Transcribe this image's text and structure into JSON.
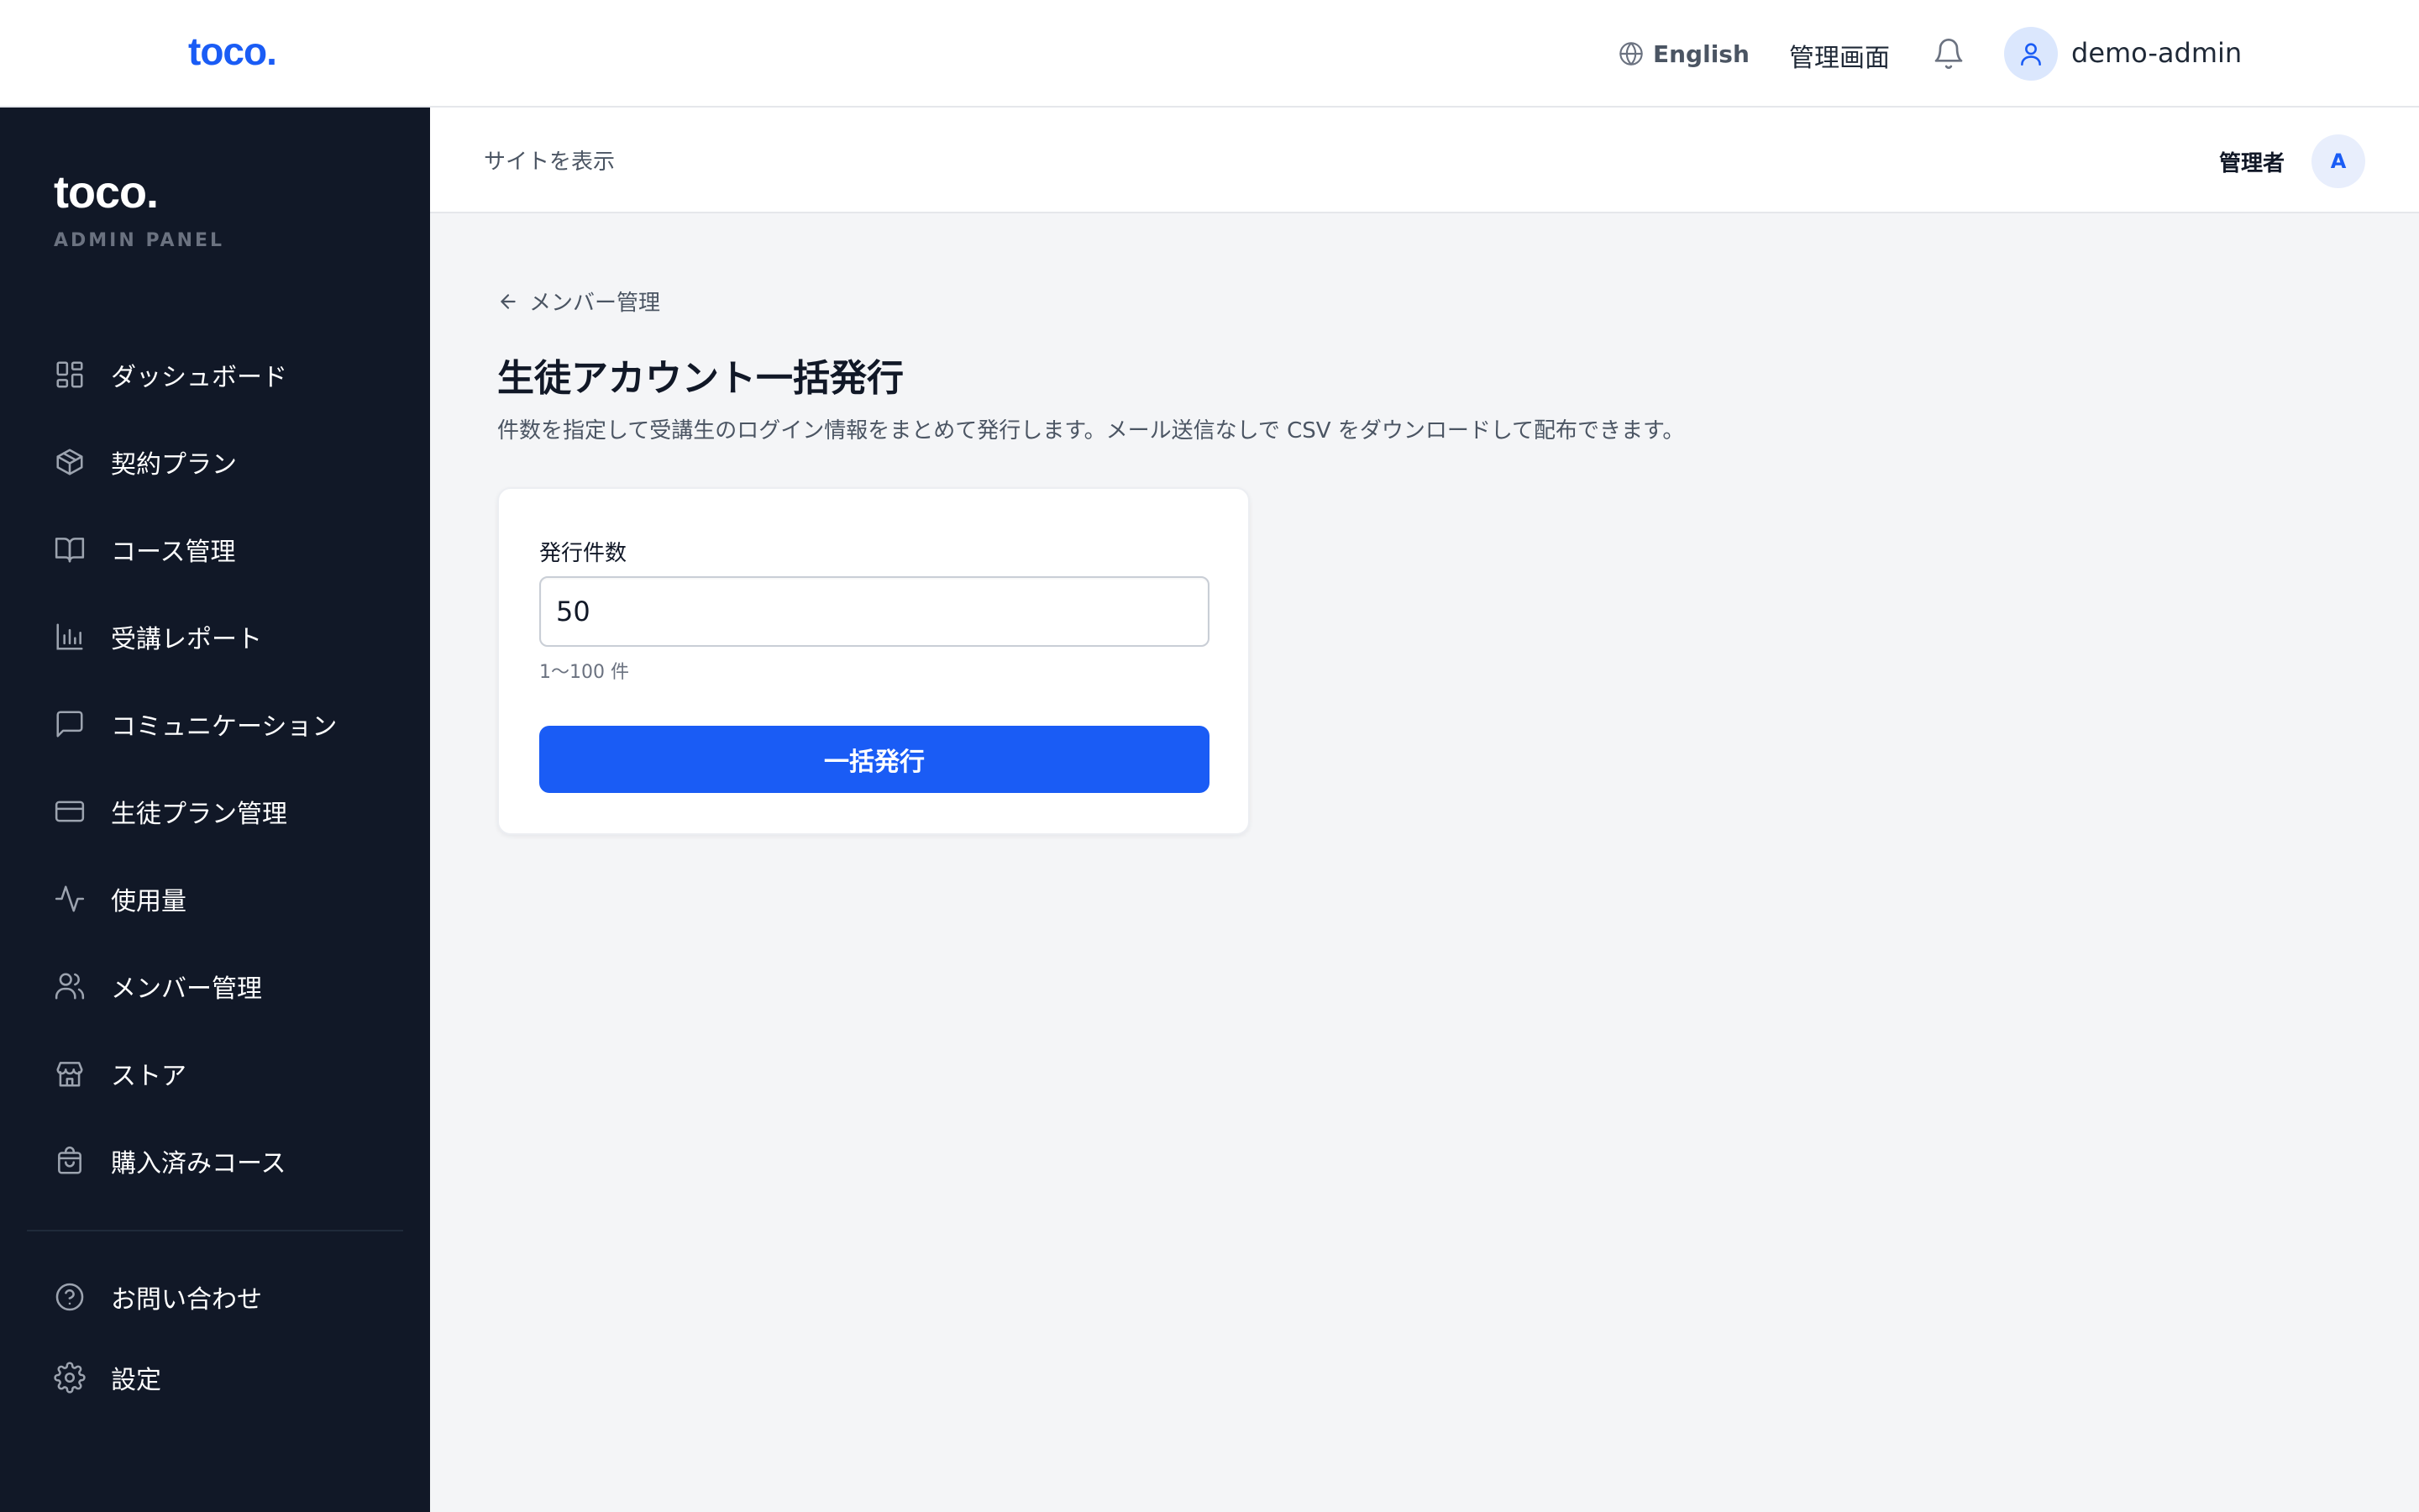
{
  "topbar": {
    "brand": "toco.",
    "language": "English",
    "admin_link": "管理画面",
    "username": "demo-admin"
  },
  "sidebar": {
    "logo": "toco.",
    "subtitle": "ADMIN PANEL",
    "items": [
      {
        "label": "ダッシュボード",
        "icon": "grid-icon"
      },
      {
        "label": "契約プラン",
        "icon": "package-icon"
      },
      {
        "label": "コース管理",
        "icon": "book-open-icon"
      },
      {
        "label": "受講レポート",
        "icon": "bar-chart-icon"
      },
      {
        "label": "コミュニケーション",
        "icon": "message-icon"
      },
      {
        "label": "生徒プラン管理",
        "icon": "credit-card-icon"
      },
      {
        "label": "使用量",
        "icon": "activity-icon"
      },
      {
        "label": "メンバー管理",
        "icon": "users-icon"
      },
      {
        "label": "ストア",
        "icon": "store-icon"
      },
      {
        "label": "購入済みコース",
        "icon": "shopping-bag-icon"
      }
    ],
    "footer_items": [
      {
        "label": "お問い合わせ",
        "icon": "help-circle-icon"
      },
      {
        "label": "設定",
        "icon": "settings-icon"
      }
    ]
  },
  "subheader": {
    "view_site": "サイトを表示",
    "role": "管理者",
    "avatar_initial": "A"
  },
  "main": {
    "back_label": "メンバー管理",
    "title": "生徒アカウント一括発行",
    "description": "件数を指定して受講生のログイン情報をまとめて発行します。メール送信なしで CSV をダウンロードして配布できます。",
    "form": {
      "count_label": "発行件数",
      "count_value": "50",
      "hint": "1〜100 件",
      "submit_label": "一括発行"
    }
  },
  "colors": {
    "accent": "#1a5cf5",
    "sidebar_bg": "#111827",
    "page_bg": "#f4f5f7"
  }
}
